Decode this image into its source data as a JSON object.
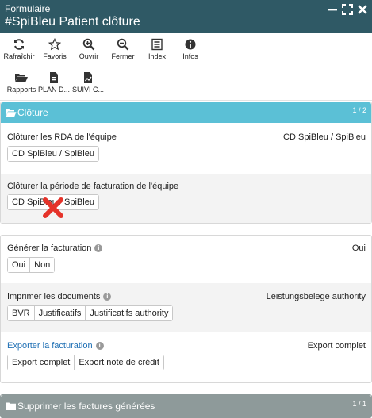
{
  "window": {
    "subtitle": "Formulaire",
    "title": "#SpiBleu Patient clôture"
  },
  "toolbar": {
    "items": [
      {
        "label": "Rafraîchir",
        "icon": "refresh-icon"
      },
      {
        "label": "Favoris",
        "icon": "star-icon"
      },
      {
        "label": "Ouvrir",
        "icon": "zoom-in-icon"
      },
      {
        "label": "Fermer",
        "icon": "zoom-out-icon"
      },
      {
        "label": "Index",
        "icon": "list-icon"
      },
      {
        "label": "Infos",
        "icon": "info-icon"
      }
    ],
    "row2": [
      {
        "label": "Rapports",
        "icon": "folder-open-icon"
      },
      {
        "label": "PLAN D...",
        "icon": "document-icon"
      },
      {
        "label": "SUIVI C...",
        "icon": "chart-document-icon"
      }
    ]
  },
  "cloture_panel": {
    "title": "Clôture",
    "counter": "1 / 2",
    "header_color": "#5bc0d6",
    "rda": {
      "label": "Clôturer les RDA de l'équipe",
      "value": "CD SpiBleu / SpiBleu",
      "button": "CD SpiBleu / SpiBleu"
    },
    "facturation_period": {
      "label": "Clôturer la période de facturation de l'équipe",
      "button": "CD SpiBleu / SpiBleu",
      "overlay_icon": "red-x-icon"
    }
  },
  "facturation_panel": {
    "generer": {
      "label": "Générer la facturation",
      "value": "Oui",
      "options": [
        "Oui",
        "Non"
      ]
    },
    "imprimer": {
      "label": "Imprimer les documents",
      "value": "Leistungsbelege authority",
      "options": [
        "BVR",
        "Justificatifs",
        "Justificatifs authority"
      ]
    },
    "exporter": {
      "label": "Exporter la facturation",
      "value": "Export complet",
      "options": [
        "Export complet",
        "Export note de crédit"
      ]
    }
  },
  "supprimer_panel": {
    "title": "Supprimer les factures générées",
    "counter": "1 / 1",
    "header_color": "#8e9a9a"
  }
}
